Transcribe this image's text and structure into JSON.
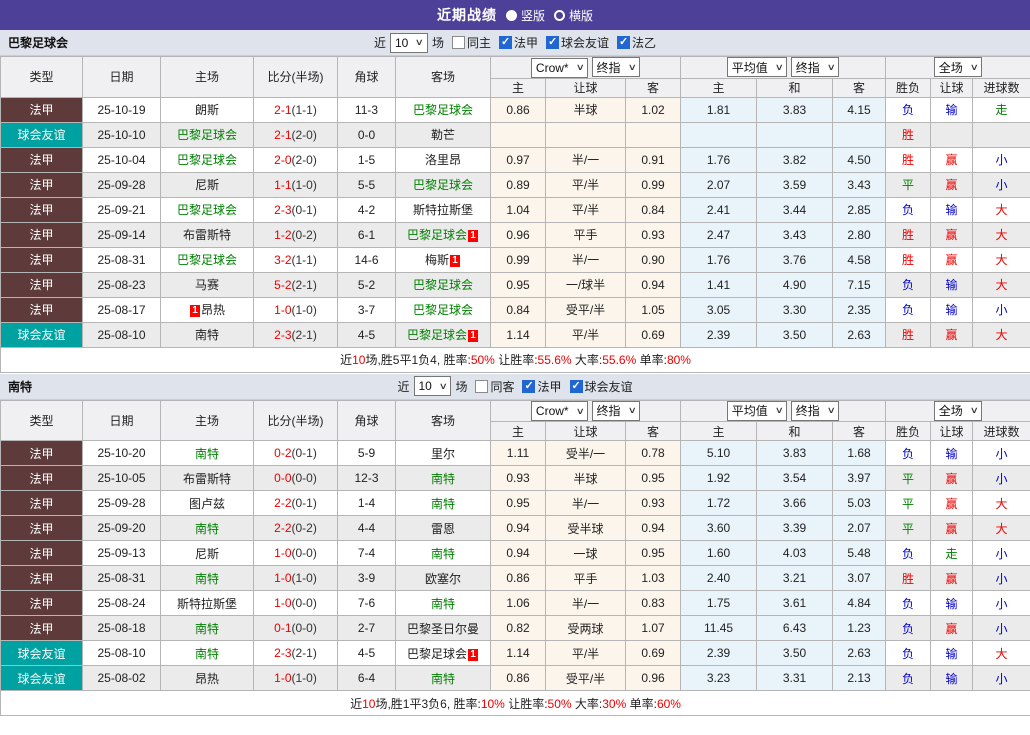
{
  "colors": {
    "header_bar": "#4d4099",
    "control_bar": "#dee3ec",
    "type_league_bg": "#5e3a3a",
    "type_friendly_bg": "#00a1a1",
    "team_highlight_green": "#008000",
    "result_red": "#ee0000",
    "result_blue": "#0000cc",
    "odds_col_bg": "#fcf5ec",
    "avg_col_bg": "#e9f4fa",
    "row_alt_bg": "#ebebeb",
    "checkbox_blue": "#2166d2"
  },
  "titlebar": {
    "title": "近期战绩",
    "views": [
      {
        "label": "竖版",
        "selected": true
      },
      {
        "label": "横版",
        "selected": false
      }
    ]
  },
  "columns": {
    "type": "类型",
    "date": "日期",
    "home": "主场",
    "score": "比分(半场)",
    "corner": "角球",
    "away": "客场",
    "odds_home": "主",
    "odds_handicap": "让球",
    "odds_away": "客",
    "avg_home": "主",
    "avg_draw": "和",
    "avg_away": "客",
    "wdl": "胜负",
    "handicap_result": "让球",
    "goals": "进球数"
  },
  "dropdowns": {
    "odds_source": "Crow*",
    "odds_stage": "终指",
    "avg_source": "平均值",
    "avg_stage": "终指",
    "scope": "全场"
  },
  "tables": [
    {
      "team": "巴黎足球会",
      "filter": {
        "prefix": "近",
        "count": "10",
        "suffix": "场",
        "checkboxes": [
          {
            "label": "同主",
            "checked": false
          },
          {
            "label": "法甲",
            "checked": true
          },
          {
            "label": "球会友谊",
            "checked": true
          },
          {
            "label": "法乙",
            "checked": true
          }
        ]
      },
      "rows": [
        {
          "type": "法甲",
          "type_style": "league",
          "date": "25-10-19",
          "home": {
            "name": "朗斯"
          },
          "score_full": "2-1",
          "score_half": "(1-1)",
          "corner": "11-3",
          "away": {
            "name": "巴黎足球会",
            "highlight": true
          },
          "odds": [
            "0.86",
            "半球",
            "1.02"
          ],
          "avg": [
            "1.81",
            "3.83",
            "4.15"
          ],
          "results": [
            {
              "t": "负",
              "c": "blue"
            },
            {
              "t": "输",
              "c": "blue"
            },
            {
              "t": "走",
              "c": "green"
            }
          ]
        },
        {
          "type": "球会友谊",
          "type_style": "friendly",
          "date": "25-10-10",
          "home": {
            "name": "巴黎足球会",
            "highlight": true
          },
          "score_full": "2-1",
          "score_half": "(2-0)",
          "corner": "0-0",
          "away": {
            "name": "勒芒"
          },
          "odds": [
            "",
            "",
            ""
          ],
          "avg": [
            "",
            "",
            ""
          ],
          "results": [
            {
              "t": "胜",
              "c": "red"
            },
            {
              "t": "",
              "c": "blue"
            },
            {
              "t": "",
              "c": "blue"
            }
          ]
        },
        {
          "type": "法甲",
          "type_style": "league",
          "date": "25-10-04",
          "home": {
            "name": "巴黎足球会",
            "highlight": true
          },
          "score_full": "2-0",
          "score_half": "(2-0)",
          "corner": "1-5",
          "away": {
            "name": "洛里昂"
          },
          "odds": [
            "0.97",
            "半/一",
            "0.91"
          ],
          "avg": [
            "1.76",
            "3.82",
            "4.50"
          ],
          "results": [
            {
              "t": "胜",
              "c": "red"
            },
            {
              "t": "赢",
              "c": "red"
            },
            {
              "t": "小",
              "c": "blue"
            }
          ]
        },
        {
          "type": "法甲",
          "type_style": "league",
          "date": "25-09-28",
          "home": {
            "name": "尼斯"
          },
          "score_full": "1-1",
          "score_half": "(1-0)",
          "corner": "5-5",
          "away": {
            "name": "巴黎足球会",
            "highlight": true
          },
          "odds": [
            "0.89",
            "平/半",
            "0.99"
          ],
          "avg": [
            "2.07",
            "3.59",
            "3.43"
          ],
          "results": [
            {
              "t": "平",
              "c": "green"
            },
            {
              "t": "赢",
              "c": "red"
            },
            {
              "t": "小",
              "c": "blue"
            }
          ]
        },
        {
          "type": "法甲",
          "type_style": "league",
          "date": "25-09-21",
          "home": {
            "name": "巴黎足球会",
            "highlight": true
          },
          "score_full": "2-3",
          "score_half": "(0-1)",
          "corner": "4-2",
          "away": {
            "name": "斯特拉斯堡"
          },
          "odds": [
            "1.04",
            "平/半",
            "0.84"
          ],
          "avg": [
            "2.41",
            "3.44",
            "2.85"
          ],
          "results": [
            {
              "t": "负",
              "c": "blue"
            },
            {
              "t": "输",
              "c": "blue"
            },
            {
              "t": "大",
              "c": "red"
            }
          ]
        },
        {
          "type": "法甲",
          "type_style": "league",
          "date": "25-09-14",
          "home": {
            "name": "布雷斯特"
          },
          "score_full": "1-2",
          "score_half": "(0-2)",
          "corner": "6-1",
          "away": {
            "name": "巴黎足球会",
            "highlight": true,
            "badge": "1",
            "badge_pos": "right"
          },
          "odds": [
            "0.96",
            "平手",
            "0.93"
          ],
          "avg": [
            "2.47",
            "3.43",
            "2.80"
          ],
          "results": [
            {
              "t": "胜",
              "c": "red"
            },
            {
              "t": "赢",
              "c": "red"
            },
            {
              "t": "大",
              "c": "red"
            }
          ]
        },
        {
          "type": "法甲",
          "type_style": "league",
          "date": "25-08-31",
          "home": {
            "name": "巴黎足球会",
            "highlight": true
          },
          "score_full": "3-2",
          "score_half": "(1-1)",
          "corner": "14-6",
          "away": {
            "name": "梅斯",
            "badge": "1",
            "badge_pos": "right"
          },
          "odds": [
            "0.99",
            "半/一",
            "0.90"
          ],
          "avg": [
            "1.76",
            "3.76",
            "4.58"
          ],
          "results": [
            {
              "t": "胜",
              "c": "red"
            },
            {
              "t": "赢",
              "c": "red"
            },
            {
              "t": "大",
              "c": "red"
            }
          ]
        },
        {
          "type": "法甲",
          "type_style": "league",
          "date": "25-08-23",
          "home": {
            "name": "马赛"
          },
          "score_full": "5-2",
          "score_half": "(2-1)",
          "corner": "5-2",
          "away": {
            "name": "巴黎足球会",
            "highlight": true
          },
          "odds": [
            "0.95",
            "一/球半",
            "0.94"
          ],
          "avg": [
            "1.41",
            "4.90",
            "7.15"
          ],
          "results": [
            {
              "t": "负",
              "c": "blue"
            },
            {
              "t": "输",
              "c": "blue"
            },
            {
              "t": "大",
              "c": "red"
            }
          ]
        },
        {
          "type": "法甲",
          "type_style": "league",
          "date": "25-08-17",
          "home": {
            "name": "昂热",
            "badge": "1",
            "badge_pos": "left"
          },
          "score_full": "1-0",
          "score_half": "(1-0)",
          "corner": "3-7",
          "away": {
            "name": "巴黎足球会",
            "highlight": true
          },
          "odds": [
            "0.84",
            "受平/半",
            "1.05"
          ],
          "avg": [
            "3.05",
            "3.30",
            "2.35"
          ],
          "results": [
            {
              "t": "负",
              "c": "blue"
            },
            {
              "t": "输",
              "c": "blue"
            },
            {
              "t": "小",
              "c": "blue"
            }
          ]
        },
        {
          "type": "球会友谊",
          "type_style": "friendly",
          "date": "25-08-10",
          "home": {
            "name": "南特"
          },
          "score_full": "2-3",
          "score_half": "(2-1)",
          "corner": "4-5",
          "away": {
            "name": "巴黎足球会",
            "highlight": true,
            "badge": "1",
            "badge_pos": "right"
          },
          "odds": [
            "1.14",
            "平/半",
            "0.69"
          ],
          "avg": [
            "2.39",
            "3.50",
            "2.63"
          ],
          "results": [
            {
              "t": "胜",
              "c": "red"
            },
            {
              "t": "赢",
              "c": "red"
            },
            {
              "t": "大",
              "c": "red"
            }
          ]
        }
      ],
      "summary": [
        {
          "t": "近",
          "c": "k"
        },
        {
          "t": "10",
          "c": "r"
        },
        {
          "t": "场,胜5平1负4, 胜率:",
          "c": "k"
        },
        {
          "t": "50%",
          "c": "r"
        },
        {
          "t": " 让胜率:",
          "c": "k"
        },
        {
          "t": "55.6%",
          "c": "r"
        },
        {
          "t": " 大率:",
          "c": "k"
        },
        {
          "t": "55.6%",
          "c": "r"
        },
        {
          "t": " 单率:",
          "c": "k"
        },
        {
          "t": "80%",
          "c": "r"
        }
      ]
    },
    {
      "team": "南特",
      "filter": {
        "prefix": "近",
        "count": "10",
        "suffix": "场",
        "checkboxes": [
          {
            "label": "同客",
            "checked": false
          },
          {
            "label": "法甲",
            "checked": true
          },
          {
            "label": "球会友谊",
            "checked": true
          }
        ]
      },
      "rows": [
        {
          "type": "法甲",
          "type_style": "league",
          "date": "25-10-20",
          "home": {
            "name": "南特",
            "highlight": true
          },
          "score_full": "0-2",
          "score_half": "(0-1)",
          "corner": "5-9",
          "away": {
            "name": "里尔"
          },
          "odds": [
            "1.11",
            "受半/一",
            "0.78"
          ],
          "avg": [
            "5.10",
            "3.83",
            "1.68"
          ],
          "results": [
            {
              "t": "负",
              "c": "blue"
            },
            {
              "t": "输",
              "c": "blue"
            },
            {
              "t": "小",
              "c": "blue"
            }
          ]
        },
        {
          "type": "法甲",
          "type_style": "league",
          "date": "25-10-05",
          "home": {
            "name": "布雷斯特"
          },
          "score_full": "0-0",
          "score_half": "(0-0)",
          "corner": "12-3",
          "away": {
            "name": "南特",
            "highlight": true
          },
          "odds": [
            "0.93",
            "半球",
            "0.95"
          ],
          "avg": [
            "1.92",
            "3.54",
            "3.97"
          ],
          "results": [
            {
              "t": "平",
              "c": "green"
            },
            {
              "t": "赢",
              "c": "red"
            },
            {
              "t": "小",
              "c": "blue"
            }
          ]
        },
        {
          "type": "法甲",
          "type_style": "league",
          "date": "25-09-28",
          "home": {
            "name": "图卢兹"
          },
          "score_full": "2-2",
          "score_half": "(0-1)",
          "corner": "1-4",
          "away": {
            "name": "南特",
            "highlight": true
          },
          "odds": [
            "0.95",
            "半/一",
            "0.93"
          ],
          "avg": [
            "1.72",
            "3.66",
            "5.03"
          ],
          "results": [
            {
              "t": "平",
              "c": "green"
            },
            {
              "t": "赢",
              "c": "red"
            },
            {
              "t": "大",
              "c": "red"
            }
          ]
        },
        {
          "type": "法甲",
          "type_style": "league",
          "date": "25-09-20",
          "home": {
            "name": "南特",
            "highlight": true
          },
          "score_full": "2-2",
          "score_half": "(0-2)",
          "corner": "4-4",
          "away": {
            "name": "雷恩"
          },
          "odds": [
            "0.94",
            "受半球",
            "0.94"
          ],
          "avg": [
            "3.60",
            "3.39",
            "2.07"
          ],
          "results": [
            {
              "t": "平",
              "c": "green"
            },
            {
              "t": "赢",
              "c": "red"
            },
            {
              "t": "大",
              "c": "red"
            }
          ]
        },
        {
          "type": "法甲",
          "type_style": "league",
          "date": "25-09-13",
          "home": {
            "name": "尼斯"
          },
          "score_full": "1-0",
          "score_half": "(0-0)",
          "corner": "7-4",
          "away": {
            "name": "南特",
            "highlight": true
          },
          "odds": [
            "0.94",
            "一球",
            "0.95"
          ],
          "avg": [
            "1.60",
            "4.03",
            "5.48"
          ],
          "results": [
            {
              "t": "负",
              "c": "blue"
            },
            {
              "t": "走",
              "c": "green"
            },
            {
              "t": "小",
              "c": "blue"
            }
          ]
        },
        {
          "type": "法甲",
          "type_style": "league",
          "date": "25-08-31",
          "home": {
            "name": "南特",
            "highlight": true
          },
          "score_full": "1-0",
          "score_half": "(1-0)",
          "corner": "3-9",
          "away": {
            "name": "欧塞尔"
          },
          "odds": [
            "0.86",
            "平手",
            "1.03"
          ],
          "avg": [
            "2.40",
            "3.21",
            "3.07"
          ],
          "results": [
            {
              "t": "胜",
              "c": "red"
            },
            {
              "t": "赢",
              "c": "red"
            },
            {
              "t": "小",
              "c": "blue"
            }
          ]
        },
        {
          "type": "法甲",
          "type_style": "league",
          "date": "25-08-24",
          "home": {
            "name": "斯特拉斯堡"
          },
          "score_full": "1-0",
          "score_half": "(0-0)",
          "corner": "7-6",
          "away": {
            "name": "南特",
            "highlight": true
          },
          "odds": [
            "1.06",
            "半/一",
            "0.83"
          ],
          "avg": [
            "1.75",
            "3.61",
            "4.84"
          ],
          "results": [
            {
              "t": "负",
              "c": "blue"
            },
            {
              "t": "输",
              "c": "blue"
            },
            {
              "t": "小",
              "c": "blue"
            }
          ]
        },
        {
          "type": "法甲",
          "type_style": "league",
          "date": "25-08-18",
          "home": {
            "name": "南特",
            "highlight": true
          },
          "score_full": "0-1",
          "score_half": "(0-0)",
          "corner": "2-7",
          "away": {
            "name": "巴黎圣日尔曼"
          },
          "odds": [
            "0.82",
            "受两球",
            "1.07"
          ],
          "avg": [
            "11.45",
            "6.43",
            "1.23"
          ],
          "results": [
            {
              "t": "负",
              "c": "blue"
            },
            {
              "t": "赢",
              "c": "red"
            },
            {
              "t": "小",
              "c": "blue"
            }
          ]
        },
        {
          "type": "球会友谊",
          "type_style": "friendly",
          "date": "25-08-10",
          "home": {
            "name": "南特",
            "highlight": true
          },
          "score_full": "2-3",
          "score_half": "(2-1)",
          "corner": "4-5",
          "away": {
            "name": "巴黎足球会",
            "badge": "1",
            "badge_pos": "right"
          },
          "odds": [
            "1.14",
            "平/半",
            "0.69"
          ],
          "avg": [
            "2.39",
            "3.50",
            "2.63"
          ],
          "results": [
            {
              "t": "负",
              "c": "blue"
            },
            {
              "t": "输",
              "c": "blue"
            },
            {
              "t": "大",
              "c": "red"
            }
          ]
        },
        {
          "type": "球会友谊",
          "type_style": "friendly",
          "date": "25-08-02",
          "home": {
            "name": "昂热"
          },
          "score_full": "1-0",
          "score_half": "(1-0)",
          "corner": "6-4",
          "away": {
            "name": "南特",
            "highlight": true
          },
          "odds": [
            "0.86",
            "受平/半",
            "0.96"
          ],
          "avg": [
            "3.23",
            "3.31",
            "2.13"
          ],
          "results": [
            {
              "t": "负",
              "c": "blue"
            },
            {
              "t": "输",
              "c": "blue"
            },
            {
              "t": "小",
              "c": "blue"
            }
          ]
        }
      ],
      "summary": [
        {
          "t": "近",
          "c": "k"
        },
        {
          "t": "10",
          "c": "r"
        },
        {
          "t": "场,胜1平3负6, 胜率:",
          "c": "k"
        },
        {
          "t": "10%",
          "c": "r"
        },
        {
          "t": " 让胜率:",
          "c": "k"
        },
        {
          "t": "50%",
          "c": "r"
        },
        {
          "t": " 大率:",
          "c": "k"
        },
        {
          "t": "30%",
          "c": "r"
        },
        {
          "t": " 单率:",
          "c": "k"
        },
        {
          "t": "60%",
          "c": "r"
        }
      ]
    }
  ]
}
